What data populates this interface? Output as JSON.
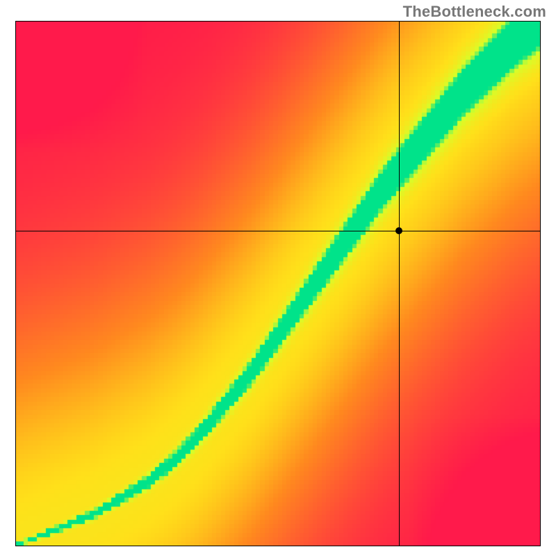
{
  "watermark": "TheBottleneck.com",
  "chart_data": {
    "type": "heatmap",
    "title": "",
    "xlabel": "",
    "ylabel": "",
    "xlim": [
      0,
      1
    ],
    "ylim": [
      0,
      1
    ],
    "grid": false,
    "legend": "none",
    "crosshair": {
      "x": 0.73,
      "y": 0.6
    },
    "marker": {
      "x": 0.73,
      "y": 0.6
    },
    "optimal_curve": {
      "description": "centerline of the green optimal band; y as a function of x on [0,1]",
      "x": [
        0.0,
        0.05,
        0.1,
        0.15,
        0.2,
        0.25,
        0.3,
        0.35,
        0.4,
        0.45,
        0.5,
        0.55,
        0.6,
        0.65,
        0.7,
        0.75,
        0.8,
        0.85,
        0.9,
        0.95,
        1.0
      ],
      "y": [
        0.0,
        0.02,
        0.04,
        0.06,
        0.09,
        0.12,
        0.16,
        0.21,
        0.27,
        0.33,
        0.4,
        0.47,
        0.54,
        0.61,
        0.68,
        0.74,
        0.8,
        0.86,
        0.91,
        0.96,
        1.0
      ]
    },
    "band_halfwidth": {
      "description": "half-thickness of the green band around the optimal curve, as a function of x",
      "x": [
        0.0,
        0.2,
        0.4,
        0.6,
        0.8,
        1.0
      ],
      "w": [
        0.005,
        0.015,
        0.03,
        0.05,
        0.07,
        0.085
      ]
    },
    "color_stops": {
      "description": "color ramp applied to the scalar field (0..1) from far-from-optimal to on-optimal",
      "stops": [
        {
          "t": 0.0,
          "hex": "#ff1a4b"
        },
        {
          "t": 0.45,
          "hex": "#ff8a1f"
        },
        {
          "t": 0.7,
          "hex": "#ffe11a"
        },
        {
          "t": 0.9,
          "hex": "#d6ff2a"
        },
        {
          "t": 1.0,
          "hex": "#00e38a"
        }
      ]
    }
  }
}
